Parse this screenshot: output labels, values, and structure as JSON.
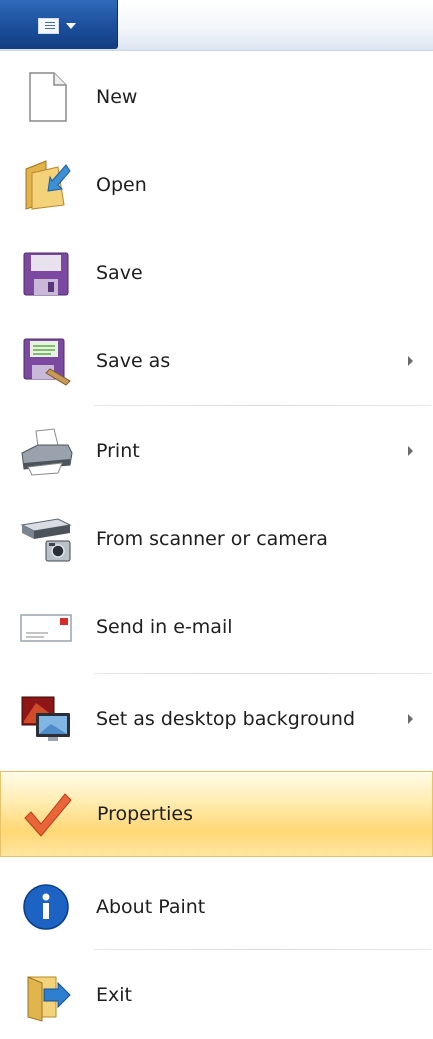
{
  "app_button": {
    "icon": "document-menu-icon",
    "dropdown_icon": "chevron-down-icon"
  },
  "menu": {
    "items": [
      {
        "label": "New",
        "icon": "blank-document-icon"
      },
      {
        "label": "Open",
        "icon": "open-folder-icon"
      },
      {
        "label": "Save",
        "icon": "floppy-disk-icon"
      },
      {
        "label": "Save as",
        "icon": "save-as-icon",
        "submenu": true
      },
      {
        "label": "Print",
        "icon": "printer-icon",
        "submenu": true
      },
      {
        "label": "From scanner or camera",
        "icon": "scanner-camera-icon"
      },
      {
        "label": "Send in e-mail",
        "icon": "email-envelope-icon"
      },
      {
        "label": "Set as desktop background",
        "icon": "desktop-background-icon",
        "submenu": true
      },
      {
        "label": "Properties",
        "icon": "checkmark-icon",
        "highlighted": true
      },
      {
        "label": "About Paint",
        "icon": "info-icon"
      },
      {
        "label": "Exit",
        "icon": "exit-icon"
      }
    ]
  },
  "colors": {
    "app_button": "#1b4f9c",
    "highlight": "#ffd774",
    "highlight_border": "#e8c26a"
  }
}
